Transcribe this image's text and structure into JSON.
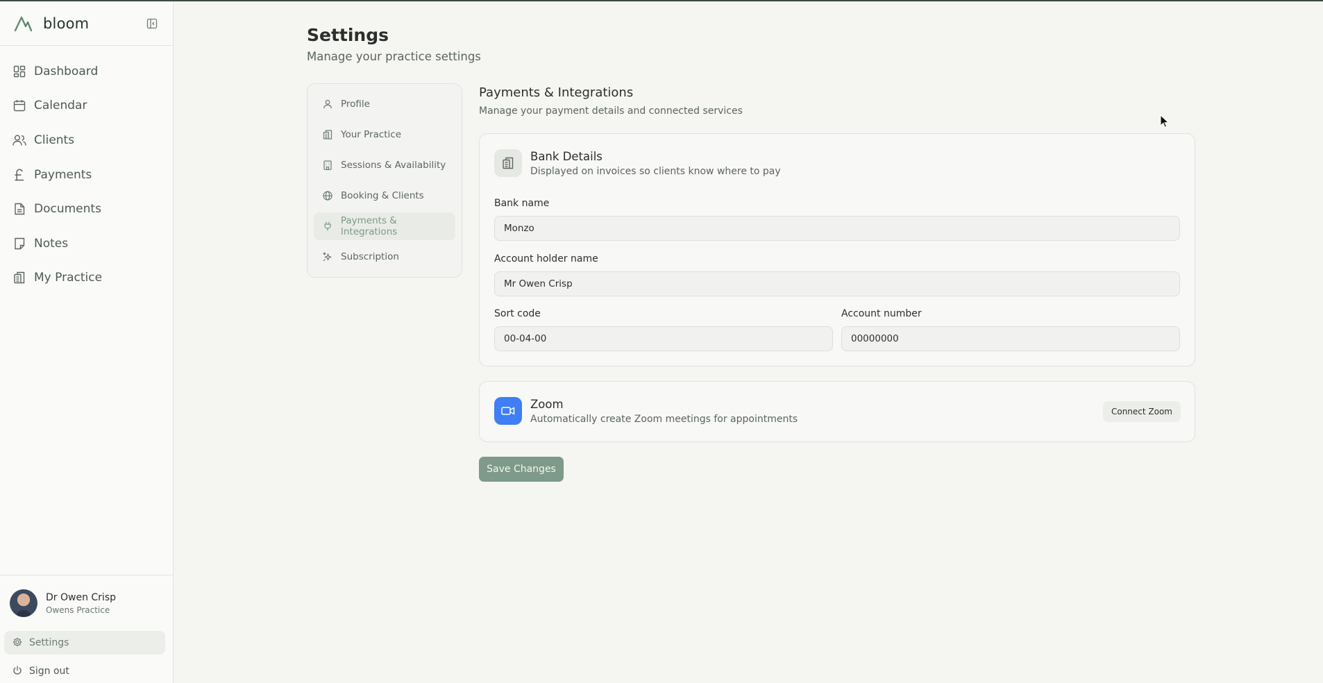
{
  "app": {
    "name": "bloom"
  },
  "sidebar": {
    "items": [
      {
        "label": "Dashboard",
        "icon": "dashboard-icon"
      },
      {
        "label": "Calendar",
        "icon": "calendar-icon"
      },
      {
        "label": "Clients",
        "icon": "users-icon"
      },
      {
        "label": "Payments",
        "icon": "pound-icon"
      },
      {
        "label": "Documents",
        "icon": "document-icon"
      },
      {
        "label": "Notes",
        "icon": "note-icon"
      },
      {
        "label": "My Practice",
        "icon": "building-icon"
      }
    ],
    "user": {
      "name": "Dr Owen Crisp",
      "practice": "Owens Practice"
    },
    "settings_label": "Settings",
    "signout_label": "Sign out"
  },
  "header": {
    "title": "Settings",
    "subtitle": "Manage your practice settings"
  },
  "settings_nav": {
    "items": [
      {
        "label": "Profile",
        "icon": "user-icon",
        "active": false
      },
      {
        "label": "Your Practice",
        "icon": "building-icon",
        "active": false
      },
      {
        "label": "Sessions & Availability",
        "icon": "office-icon",
        "active": false
      },
      {
        "label": "Booking & Clients",
        "icon": "globe-icon",
        "active": false
      },
      {
        "label": "Payments & Integrations",
        "icon": "plug-icon",
        "active": true
      },
      {
        "label": "Subscription",
        "icon": "sparkles-icon",
        "active": false
      }
    ]
  },
  "section": {
    "title": "Payments & Integrations",
    "subtitle": "Manage your payment details and connected services"
  },
  "bank": {
    "title": "Bank Details",
    "subtitle": "Displayed on invoices so clients know where to pay",
    "bank_name_label": "Bank name",
    "bank_name_value": "Monzo",
    "holder_label": "Account holder name",
    "holder_value": "Mr Owen Crisp",
    "sort_code_label": "Sort code",
    "sort_code_value": "00-04-00",
    "account_number_label": "Account number",
    "account_number_value": "00000000"
  },
  "zoom": {
    "title": "Zoom",
    "subtitle": "Automatically create Zoom meetings for appointments",
    "button_label": "Connect Zoom"
  },
  "save_label": "Save Changes",
  "colors": {
    "accent": "#7e9a88",
    "zoom_blue": "#3f7ef4",
    "background": "#f5f5f2"
  }
}
